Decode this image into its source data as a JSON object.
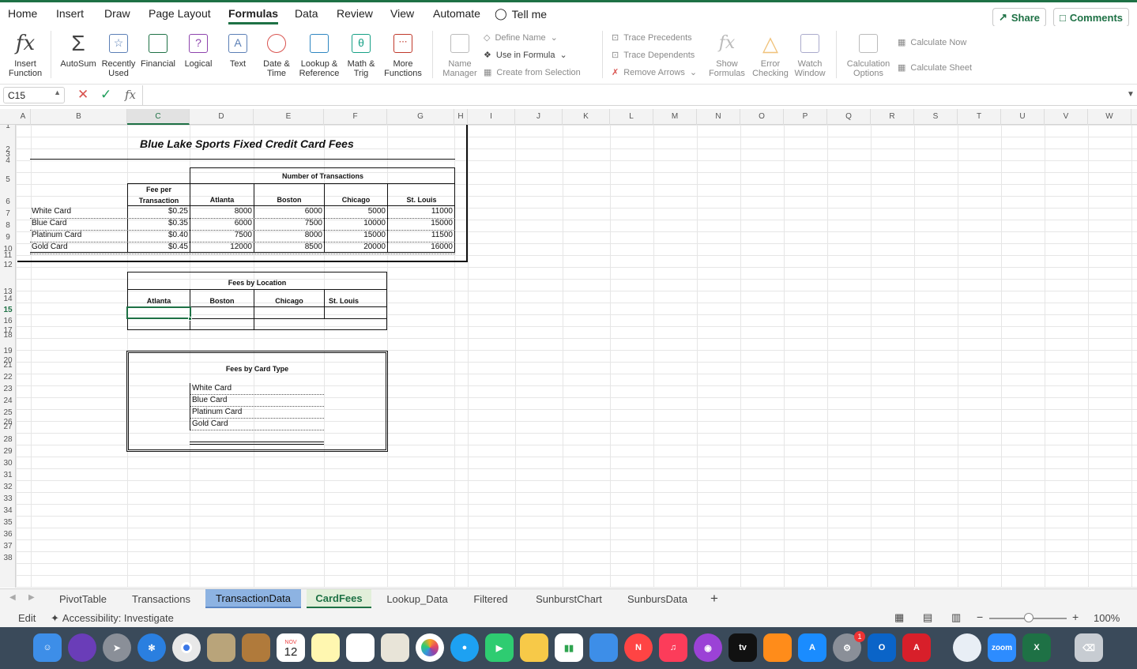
{
  "menu": {
    "items": [
      "Home",
      "Insert",
      "Draw",
      "Page Layout",
      "Formulas",
      "Data",
      "Review",
      "View",
      "Automate"
    ],
    "tell_me": "Tell me",
    "share": "Share",
    "comments": "Comments"
  },
  "ribbon": {
    "insert_function": [
      "Insert",
      "Function"
    ],
    "autosum": "AutoSum",
    "recently_used": [
      "Recently",
      "Used"
    ],
    "financial": "Financial",
    "logical": "Logical",
    "text": "Text",
    "date_time": [
      "Date &",
      "Time"
    ],
    "lookup_reference": [
      "Lookup &",
      "Reference"
    ],
    "math_trig": [
      "Math &",
      "Trig"
    ],
    "more_functions": [
      "More",
      "Functions"
    ],
    "name_manager": [
      "Name",
      "Manager"
    ],
    "define_name": "Define Name",
    "use_in_formula": "Use in Formula",
    "create_from_selection": "Create from Selection",
    "trace_precedents": "Trace Precedents",
    "trace_dependents": "Trace Dependents",
    "remove_arrows": "Remove Arrows",
    "show_formulas": [
      "Show",
      "Formulas"
    ],
    "error_checking": [
      "Error",
      "Checking"
    ],
    "watch_window": [
      "Watch",
      "Window"
    ],
    "calculation_options": [
      "Calculation",
      "Options"
    ],
    "calculate_now": "Calculate Now",
    "calculate_sheet": "Calculate Sheet"
  },
  "formula_bar": {
    "name_box": "C15",
    "fx": "fx",
    "value": ""
  },
  "columns": [
    "A",
    "B",
    "C",
    "D",
    "E",
    "F",
    "G",
    "H",
    "I",
    "J",
    "K",
    "L",
    "M",
    "N",
    "O",
    "P",
    "Q",
    "R",
    "S",
    "T",
    "U",
    "V",
    "W"
  ],
  "rows": [
    "1",
    "2",
    "3",
    "4",
    "5",
    "6",
    "7",
    "8",
    "9",
    "10",
    "11",
    "12",
    "13",
    "14",
    "15",
    "16",
    "17",
    "18",
    "19",
    "20",
    "21",
    "22",
    "23",
    "24",
    "25",
    "26",
    "27",
    "28",
    "29",
    "30",
    "31",
    "32",
    "33",
    "34",
    "35",
    "36",
    "37",
    "38"
  ],
  "sheet": {
    "title": "Blue Lake Sports Fixed Credit Card Fees",
    "num_transactions_header": "Number of Transactions",
    "fee_header": [
      "Fee per",
      "Transaction"
    ],
    "cities": [
      "Atlanta",
      "Boston",
      "Chicago",
      "St. Louis"
    ],
    "cards": [
      {
        "name": "White Card",
        "fee": "$0.25",
        "values": [
          "8000",
          "6000",
          "5000",
          "11000"
        ]
      },
      {
        "name": "Blue Card",
        "fee": "$0.35",
        "values": [
          "6000",
          "7500",
          "10000",
          "15000"
        ]
      },
      {
        "name": "Platinum Card",
        "fee": "$0.40",
        "values": [
          "7500",
          "8000",
          "15000",
          "11500"
        ]
      },
      {
        "name": "Gold Card",
        "fee": "$0.45",
        "values": [
          "12000",
          "8500",
          "20000",
          "16000"
        ]
      }
    ],
    "fees_by_location": "Fees by Location",
    "fees_by_card_type": "Fees by Card Type"
  },
  "tabs": [
    "PivotTable",
    "Transactions",
    "TransactionData",
    "CardFees",
    "Lookup_Data",
    "Filtered",
    "SunburstChart",
    "SunbursData"
  ],
  "status": {
    "mode": "Edit",
    "accessibility": "Accessibility: Investigate",
    "zoom": "100%"
  },
  "dock": {
    "calendar_month": "NOV",
    "calendar_day": "12",
    "zoom_label": "zoom",
    "badge": "1"
  }
}
